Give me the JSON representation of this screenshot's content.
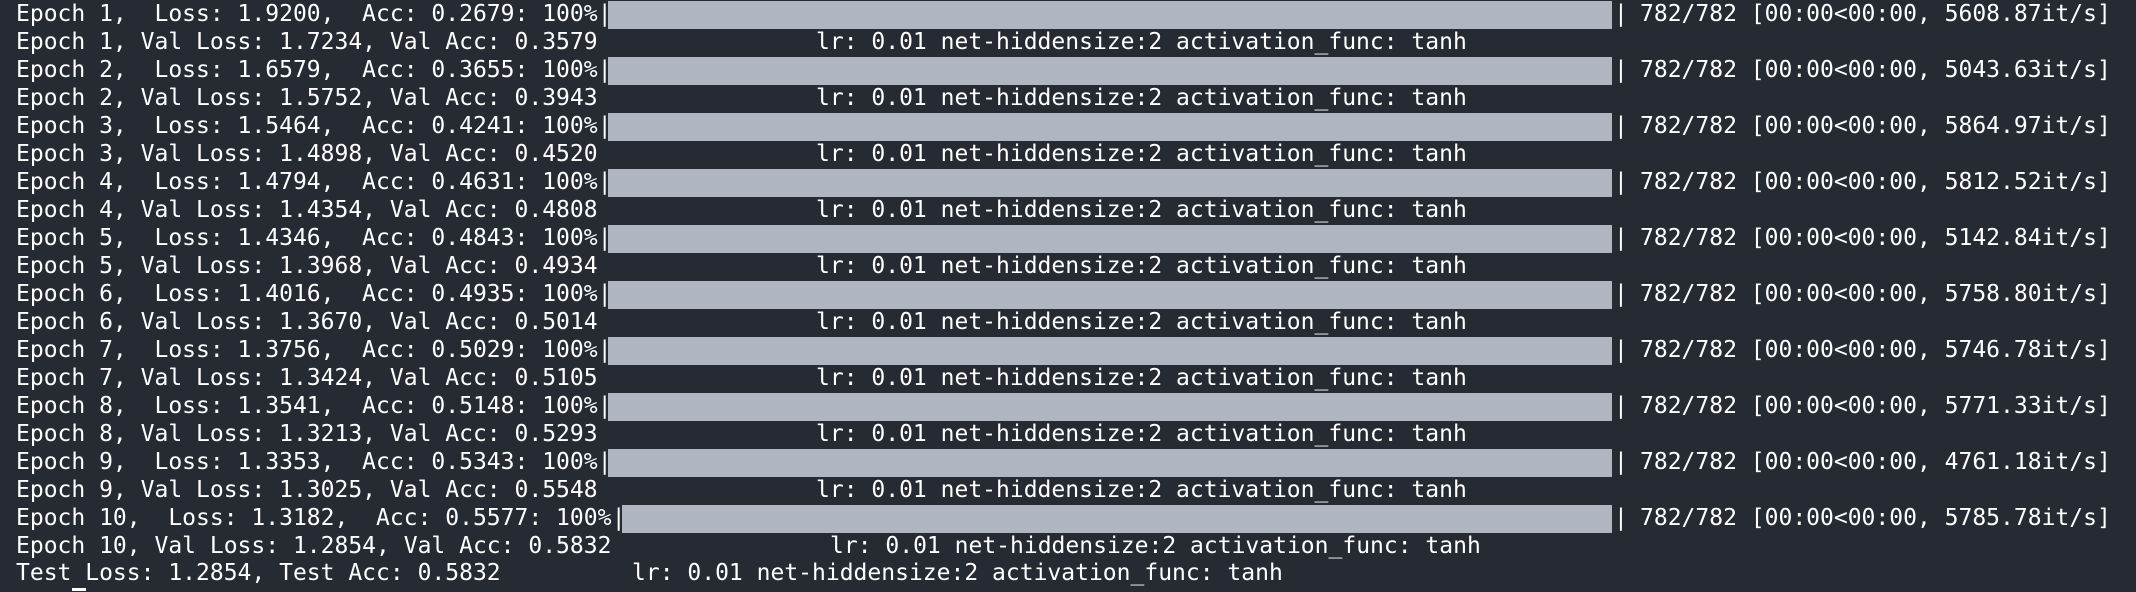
{
  "epochs": [
    {
      "train": "Epoch 1,  Loss: 1.9200,  Acc: 0.2679: 100%",
      "tail": "782/782 [00:00<00:00, 5608.87it/s]",
      "progress": 1.0,
      "val": "Epoch 1, Val Loss: 1.7234, Val Acc: 0.3579",
      "info": "lr: 0.01 net-hiddensize:2 activation_func: tanh"
    },
    {
      "train": "Epoch 2,  Loss: 1.6579,  Acc: 0.3655: 100%",
      "tail": "782/782 [00:00<00:00, 5043.63it/s]",
      "progress": 1.0,
      "val": "Epoch 2, Val Loss: 1.5752, Val Acc: 0.3943",
      "info": "lr: 0.01 net-hiddensize:2 activation_func: tanh"
    },
    {
      "train": "Epoch 3,  Loss: 1.5464,  Acc: 0.4241: 100%",
      "tail": "782/782 [00:00<00:00, 5864.97it/s]",
      "progress": 1.0,
      "val": "Epoch 3, Val Loss: 1.4898, Val Acc: 0.4520",
      "info": "lr: 0.01 net-hiddensize:2 activation_func: tanh"
    },
    {
      "train": "Epoch 4,  Loss: 1.4794,  Acc: 0.4631: 100%",
      "tail": "782/782 [00:00<00:00, 5812.52it/s]",
      "progress": 1.0,
      "val": "Epoch 4, Val Loss: 1.4354, Val Acc: 0.4808",
      "info": "lr: 0.01 net-hiddensize:2 activation_func: tanh"
    },
    {
      "train": "Epoch 5,  Loss: 1.4346,  Acc: 0.4843: 100%",
      "tail": "782/782 [00:00<00:00, 5142.84it/s]",
      "progress": 1.0,
      "val": "Epoch 5, Val Loss: 1.3968, Val Acc: 0.4934",
      "info": "lr: 0.01 net-hiddensize:2 activation_func: tanh"
    },
    {
      "train": "Epoch 6,  Loss: 1.4016,  Acc: 0.4935: 100%",
      "tail": "782/782 [00:00<00:00, 5758.80it/s]",
      "progress": 1.0,
      "val": "Epoch 6, Val Loss: 1.3670, Val Acc: 0.5014",
      "info": "lr: 0.01 net-hiddensize:2 activation_func: tanh"
    },
    {
      "train": "Epoch 7,  Loss: 1.3756,  Acc: 0.5029: 100%",
      "tail": "782/782 [00:00<00:00, 5746.78it/s]",
      "progress": 1.0,
      "val": "Epoch 7, Val Loss: 1.3424, Val Acc: 0.5105",
      "info": "lr: 0.01 net-hiddensize:2 activation_func: tanh"
    },
    {
      "train": "Epoch 8,  Loss: 1.3541,  Acc: 0.5148: 100%",
      "tail": "782/782 [00:00<00:00, 5771.33it/s]",
      "progress": 1.0,
      "val": "Epoch 8, Val Loss: 1.3213, Val Acc: 0.5293",
      "info": "lr: 0.01 net-hiddensize:2 activation_func: tanh"
    },
    {
      "train": "Epoch 9,  Loss: 1.3353,  Acc: 0.5343: 100%",
      "tail": "782/782 [00:00<00:00, 4761.18it/s]",
      "progress": 1.0,
      "val": "Epoch 9, Val Loss: 1.3025, Val Acc: 0.5548",
      "info": "lr: 0.01 net-hiddensize:2 activation_func: tanh"
    },
    {
      "train": "Epoch 10,  Loss: 1.3182,  Acc: 0.5577: 100%",
      "tail": "782/782 [00:00<00:00, 5785.78it/s]",
      "progress": 1.0,
      "val": "Epoch 10, Val Loss: 1.2854, Val Acc: 0.5832",
      "info": "lr: 0.01 net-hiddensize:2 activation_func: tanh"
    }
  ],
  "test": {
    "text": "Test Loss: 1.2854, Test Acc: 0.5832",
    "info": "lr: 0.01 net-hiddensize:2 activation_func: tanh"
  },
  "colors": {
    "background": "#262a33",
    "text": "#ffffff",
    "bar": "#b0b5c2"
  }
}
